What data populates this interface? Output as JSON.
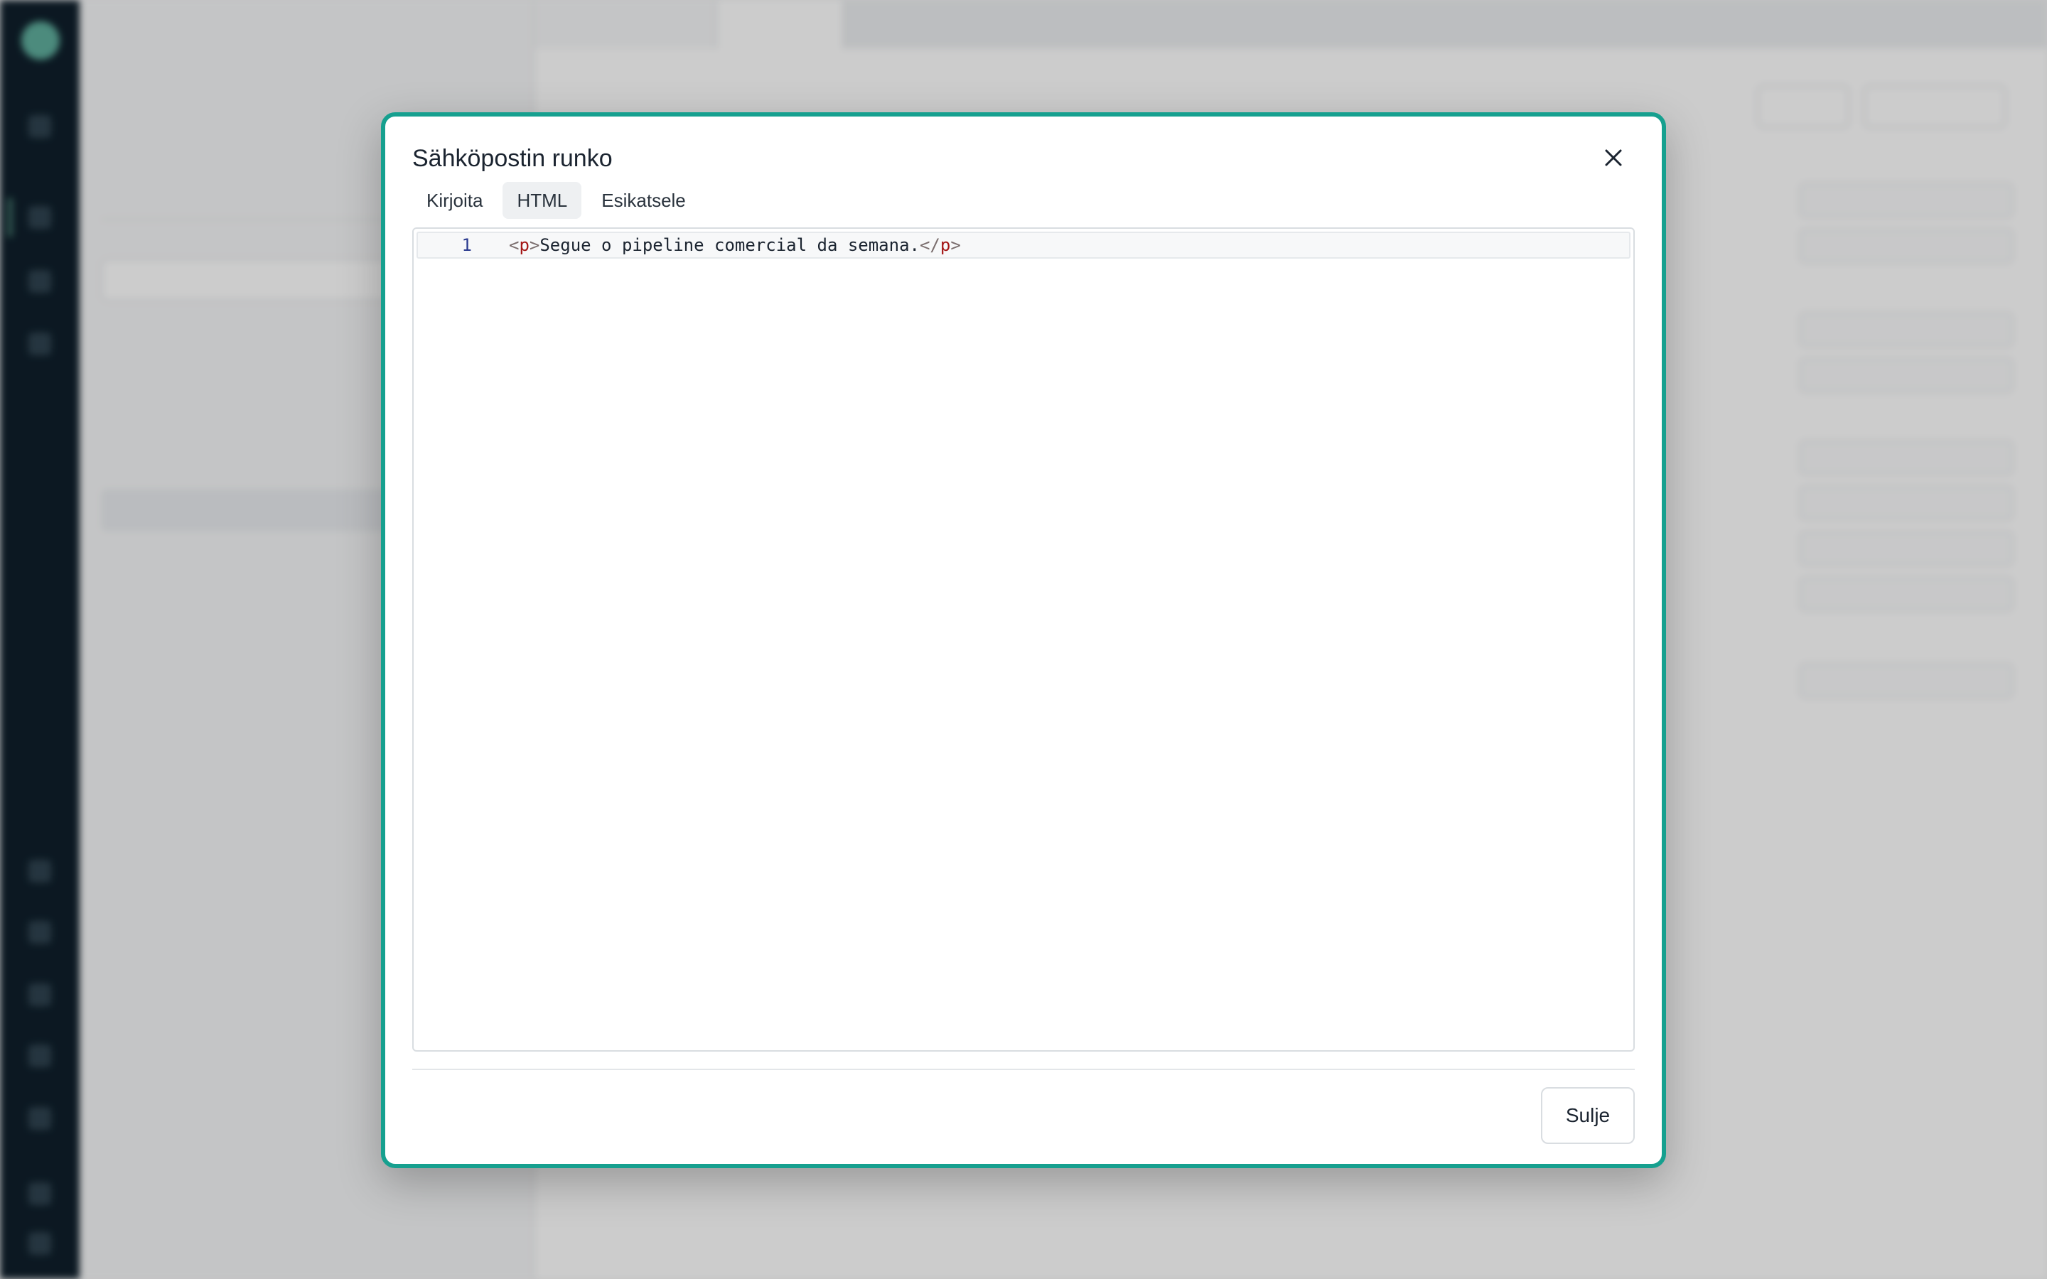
{
  "modal": {
    "title": "Sähköpostin runko",
    "tabs": [
      {
        "label": "Kirjoita"
      },
      {
        "label": "HTML",
        "active": true
      },
      {
        "label": "Esikatsele"
      }
    ],
    "editor": {
      "lines": [
        {
          "number": "1",
          "tokens": [
            {
              "type": "punct",
              "text": "<"
            },
            {
              "type": "tag",
              "text": "p"
            },
            {
              "type": "punct",
              "text": ">"
            },
            {
              "type": "text",
              "text": "Segue o pipeline comercial da semana."
            },
            {
              "type": "punct",
              "text": "</"
            },
            {
              "type": "tag",
              "text": "p"
            },
            {
              "type": "punct",
              "text": ">"
            }
          ]
        }
      ]
    },
    "close_label": "Sulje",
    "accent_color": "#16a08f"
  }
}
